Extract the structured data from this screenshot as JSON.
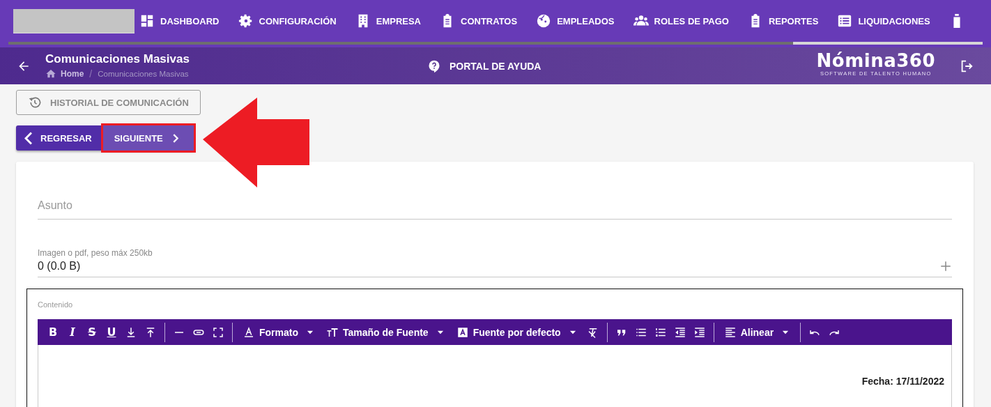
{
  "nav": {
    "items": [
      {
        "label": "DASHBOARD"
      },
      {
        "label": "CONFIGURACIÓN"
      },
      {
        "label": "EMPRESA"
      },
      {
        "label": "CONTRATOS"
      },
      {
        "label": "EMPLEADOS"
      },
      {
        "label": "ROLES DE PAGO"
      },
      {
        "label": "REPORTES"
      },
      {
        "label": "LIQUIDACIONES"
      }
    ]
  },
  "header": {
    "title": "Comunicaciones Masivas",
    "breadcrumb": [
      "Home",
      "/",
      "Comunicaciones Masivas"
    ],
    "help": "PORTAL DE AYUDA",
    "logo": {
      "name": "Nómina360",
      "tagline": "SOFTWARE DE TALENTO HUMANO"
    }
  },
  "history_button": "HISTORIAL DE COMUNICACIÓN",
  "buttons": [
    {
      "label": "REGRESAR",
      "kind": "back",
      "highlighted": false
    },
    {
      "label": "SIGUIENTE",
      "kind": "next",
      "highlighted": true
    }
  ],
  "form": {
    "subject": {
      "placeholder": "Asunto"
    },
    "file": {
      "label": "Imagen o pdf, peso máx 250kb",
      "value": "0 (0.0 B)"
    },
    "editor": {
      "label": "Contenido",
      "toolbar": [
        [
          {
            "kind": "glyph",
            "label": "B"
          },
          {
            "kind": "glyph",
            "label": "I"
          },
          {
            "kind": "glyph",
            "label": "S"
          },
          {
            "kind": "glyph",
            "label": "U"
          },
          {
            "kind": "icon"
          },
          {
            "kind": "icon"
          }
        ],
        [
          {
            "kind": "icon"
          },
          {
            "kind": "icon"
          },
          {
            "kind": "icon"
          }
        ],
        [
          {
            "kind": "dropdown",
            "label": "Formato"
          },
          {
            "kind": "dropdown",
            "label": "Tamaño de Fuente"
          },
          {
            "kind": "dropdown",
            "label": "Fuente por defecto"
          },
          {
            "kind": "icon"
          }
        ],
        [
          {
            "kind": "icon"
          },
          {
            "kind": "icon"
          },
          {
            "kind": "icon"
          },
          {
            "kind": "icon"
          },
          {
            "kind": "icon"
          }
        ],
        [
          {
            "kind": "dropdown",
            "label": "Alinear"
          }
        ],
        [
          {
            "kind": "icon"
          },
          {
            "kind": "icon"
          }
        ]
      ],
      "content": "Fecha: 17/11/2022"
    }
  }
}
